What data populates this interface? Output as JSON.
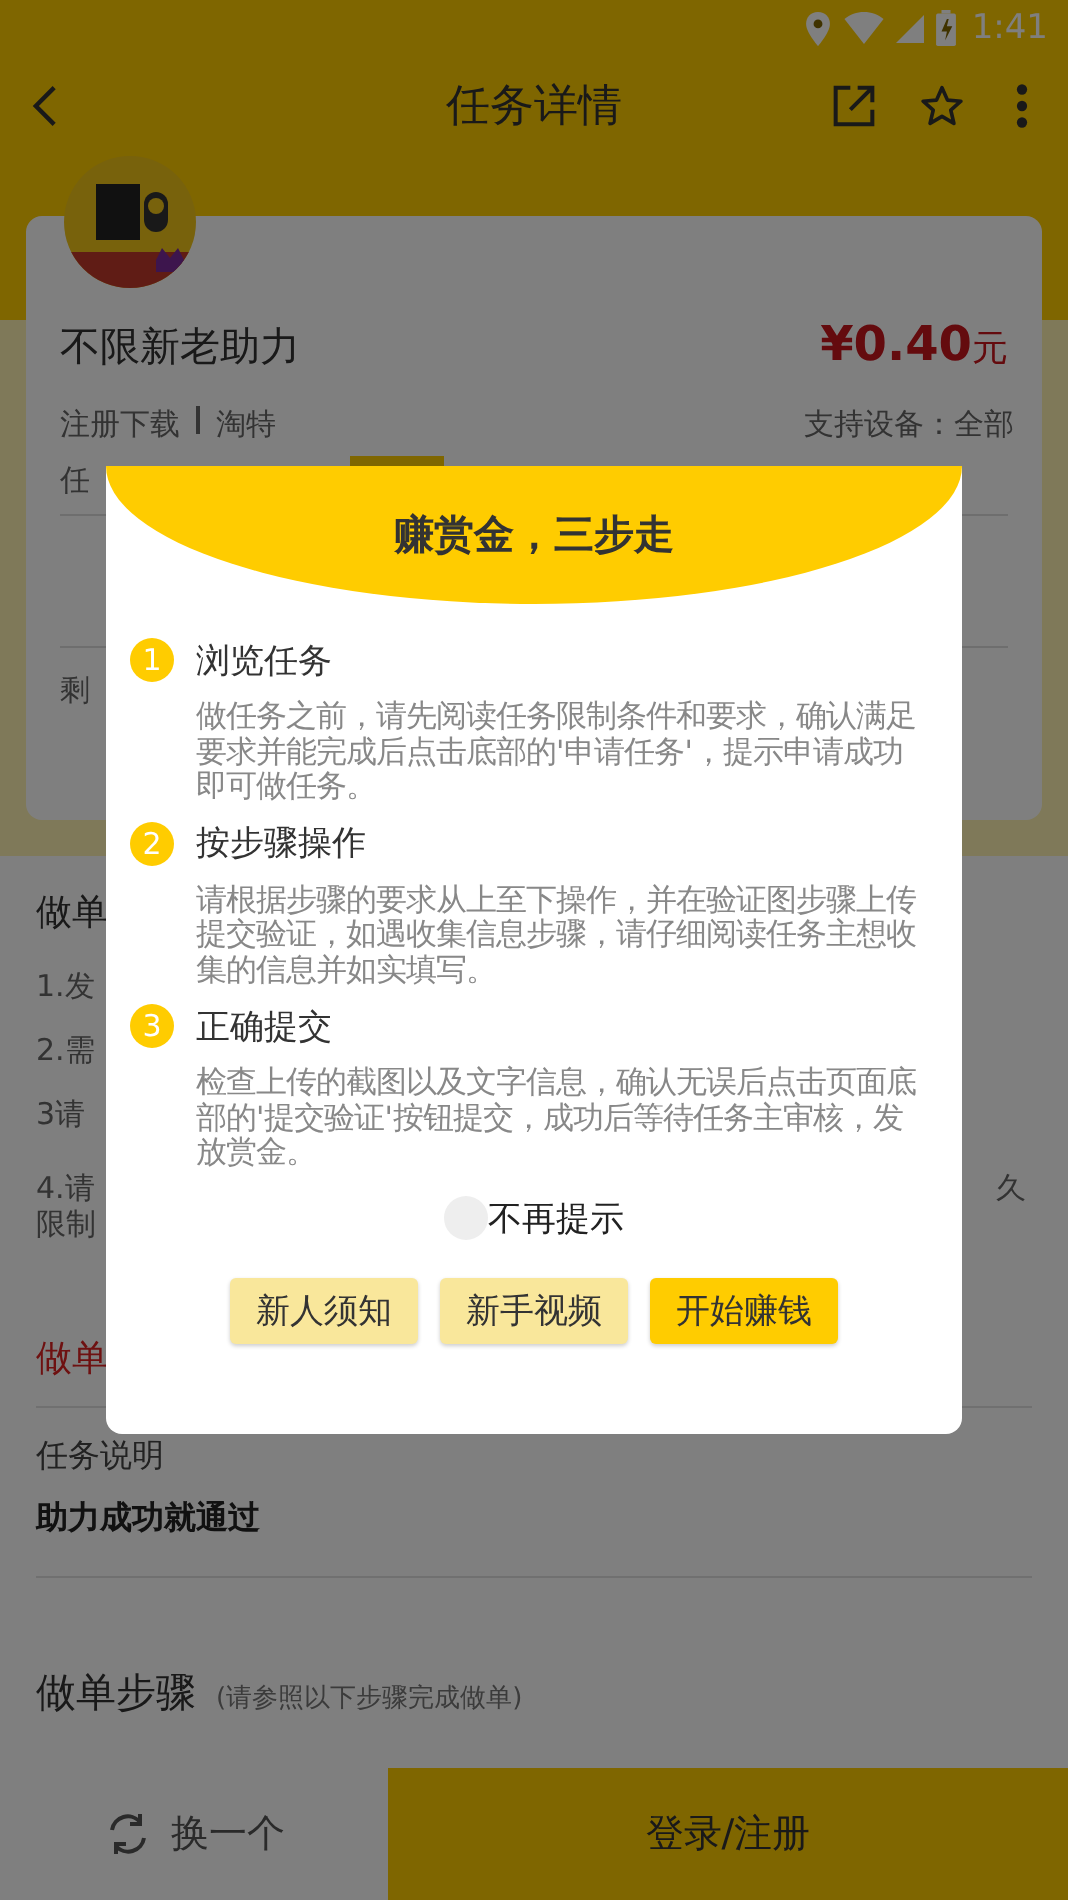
{
  "status_bar": {
    "time": "1:41"
  },
  "app_bar": {
    "title": "任务详情"
  },
  "task_card": {
    "logo": {
      "kind": "picture"
    },
    "title": "不限新老助力",
    "price": "¥0.40",
    "price_unit": "元",
    "tags": [
      "注册下载",
      "淘特"
    ],
    "devices": "支持设备：全部",
    "row_1": "任",
    "row_3": "剩"
  },
  "steps_section": {
    "title": "做单",
    "items": [
      "1.发",
      "2.需",
      "3请",
      "4.请",
      "限制"
    ],
    "right_fragment": "久",
    "red_text": "做单"
  },
  "description": {
    "label": "任务说明",
    "text": "助力成功就通过"
  },
  "procedure": {
    "title": "做单步骤",
    "hint": "(请参照以下步骤完成做单)"
  },
  "bottom_bar": {
    "switch_label": "换一个",
    "login_label": "登录/注册"
  },
  "dialog": {
    "title": "赚赏金，三步走",
    "steps": [
      {
        "number": "1",
        "title": "浏览任务",
        "text": "做任务之前，请先阅读任务限制条件和要求，确认满足要求并能完成后点击底部的'申请任务'，提示申请成功即可做任务。"
      },
      {
        "number": "2",
        "title": "按步骤操作",
        "text": "请根据步骤的要求从上至下操作，并在验证图步骤上传提交验证，如遇收集信息步骤，请仔细阅读任务主想收集的信息并如实填写。"
      },
      {
        "number": "3",
        "title": "正确提交",
        "text": "检查上传的截图以及文字信息，确认无误后点击页面底部的'提交验证'按钮提交，成功后等待任务主审核，发放赏金。"
      }
    ],
    "dont_show_again": {
      "label": "不再提示",
      "checked": false
    },
    "buttons": [
      {
        "label": "新人须知",
        "kind": "secondary"
      },
      {
        "label": "新手视频",
        "kind": "secondary"
      },
      {
        "label": "开始赚钱",
        "kind": "primary"
      }
    ]
  }
}
